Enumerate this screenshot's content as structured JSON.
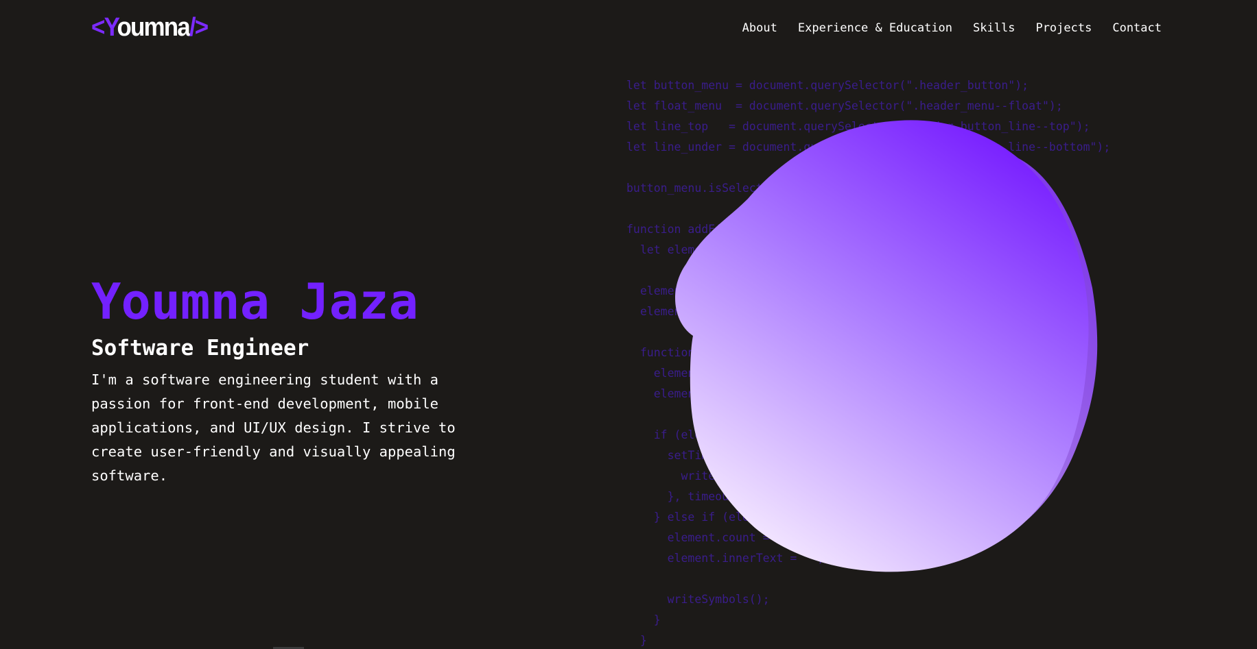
{
  "header": {
    "logo": {
      "open": "<Y",
      "middle": "oumna",
      "close": "/>"
    },
    "nav": [
      {
        "label": "About"
      },
      {
        "label": "Experience & Education"
      },
      {
        "label": "Skills"
      },
      {
        "label": "Projects"
      },
      {
        "label": "Contact"
      }
    ]
  },
  "hero": {
    "name": "Youmna Jaza",
    "role": "Software Engineer",
    "description": "I'm a software engineering student with a passion for front-end development, mobile applications, and UI/UX design. I strive to create user-friendly and visually appealing software."
  },
  "background_code": "let button_menu = document.querySelector(\".header_button\");\nlet float_menu  = document.querySelector(\".header_menu--float\");\nlet line_top   = document.querySelector(\".header_button_line--top\");\nlet line_under = document.querySelector(\".header_button_line--bottom\");\n\nbutton_menu.isSelected = false;\n\nfunction addEffect() {\n  let element = this;\n\n  element.count = 0;\n  element.text = element.innerText;\n\n  function writeSymbols() {\n    element.count++;\n    element.innerText = element.text.slice(0, element.count);\n\n    if (element.count < element.text.length) {\n      setTimeout(function () {\n        writeSymbols();\n      }, timeout);\n    } else if (element.count >= element.text.length) {\n      element.count = 0;\n      element.innerText = \"\";\n\n      writeSymbols();\n    }\n  }\n",
  "colors": {
    "background": "#1c1a18",
    "accent": "#7321ff",
    "code": "#3a1d8c",
    "blob_top": "#7a22ff",
    "blob_bottom": "#f7ecff"
  }
}
